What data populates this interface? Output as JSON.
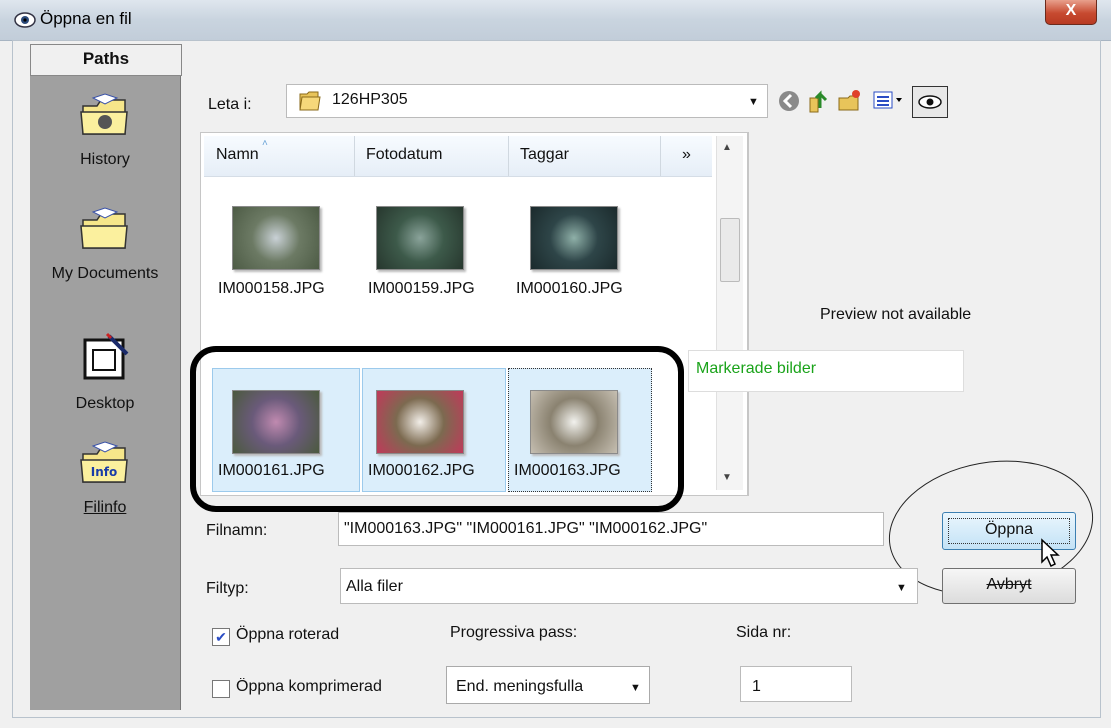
{
  "window": {
    "title": "Öppna en fil",
    "close_label": "X"
  },
  "places": {
    "header": "Paths",
    "items": [
      {
        "label": "History",
        "icon": "history-folder-icon"
      },
      {
        "label": "My Documents",
        "icon": "documents-folder-icon"
      },
      {
        "label": "Desktop",
        "icon": "desktop-icon"
      },
      {
        "label": "Filinfo",
        "icon": "info-folder-icon"
      }
    ]
  },
  "look_in": {
    "label": "Leta i:",
    "value": "126HP305"
  },
  "toolbar": {
    "icons": [
      "back-icon",
      "up-folder-icon",
      "new-folder-icon",
      "view-menu-icon",
      "preview-toggle-icon"
    ]
  },
  "filelist": {
    "columns": [
      "Namn",
      "Fotodatum",
      "Taggar",
      "»"
    ],
    "files": [
      {
        "name": "IM000158.JPG",
        "selected": false,
        "colors": [
          "#6c7a64",
          "#c9d1d6",
          "#4d5b45"
        ]
      },
      {
        "name": "IM000159.JPG",
        "selected": false,
        "colors": [
          "#3d5a4a",
          "#8aa39a",
          "#27372e"
        ]
      },
      {
        "name": "IM000160.JPG",
        "selected": false,
        "colors": [
          "#2e4548",
          "#8fb0a8",
          "#1b2a2c"
        ]
      },
      {
        "name": "IM000161.JPG",
        "selected": true,
        "colors": [
          "#6a5a7a",
          "#c08ab0",
          "#4b5a3e"
        ]
      },
      {
        "name": "IM000162.JPG",
        "selected": true,
        "colors": [
          "#7c6a50",
          "#f2eee8",
          "#c03a5a"
        ]
      },
      {
        "name": "IM000163.JPG",
        "selected": true,
        "colors": [
          "#8a8270",
          "#f2f2ee",
          "#c6bfb2"
        ]
      }
    ]
  },
  "preview": {
    "text": "Preview not available"
  },
  "annotation": {
    "text": "Markerade bilder",
    "color": "#1aa31a"
  },
  "filename": {
    "label": "Filnamn:",
    "value": "\"IM000163.JPG\" \"IM000161.JPG\" \"IM000162.JPG\""
  },
  "filetype": {
    "label": "Filtyp:",
    "value": "Alla filer"
  },
  "buttons": {
    "open": "Öppna",
    "cancel": "Avbryt"
  },
  "options": {
    "open_rotated": {
      "label": "Öppna roterad",
      "checked": true
    },
    "open_compressed": {
      "label": "Öppna komprimerad",
      "checked": false
    },
    "progressive": {
      "label": "Progressiva pass:",
      "value": "End. meningsfulla"
    },
    "page": {
      "label": "Sida nr:",
      "value": "1"
    }
  }
}
